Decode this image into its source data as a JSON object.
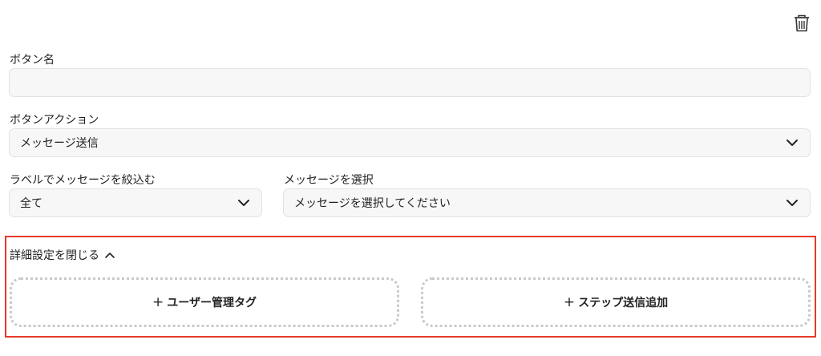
{
  "icons": {
    "trash": "trash-icon",
    "chevron": "chevron-down-icon",
    "collapse": "chevron-up-icon",
    "plus": "plus-icon"
  },
  "colors": {
    "highlight_border": "#e53a2c",
    "field_bg": "#f7f7f8",
    "dotted_border": "#c9c9cc"
  },
  "button_name": {
    "label": "ボタン名",
    "value": ""
  },
  "button_action": {
    "label": "ボタンアクション",
    "selected": "メッセージ送信"
  },
  "label_filter": {
    "label": "ラベルでメッセージを絞込む",
    "selected": "全て"
  },
  "message_select": {
    "label": "メッセージを選択",
    "selected": "メッセージを選択してください"
  },
  "advanced": {
    "toggle_label": "詳細設定を閉じる",
    "add_user_tag_label": "ユーザー管理タグ",
    "add_step_label": "ステップ送信追加",
    "plus_glyph": "+"
  }
}
